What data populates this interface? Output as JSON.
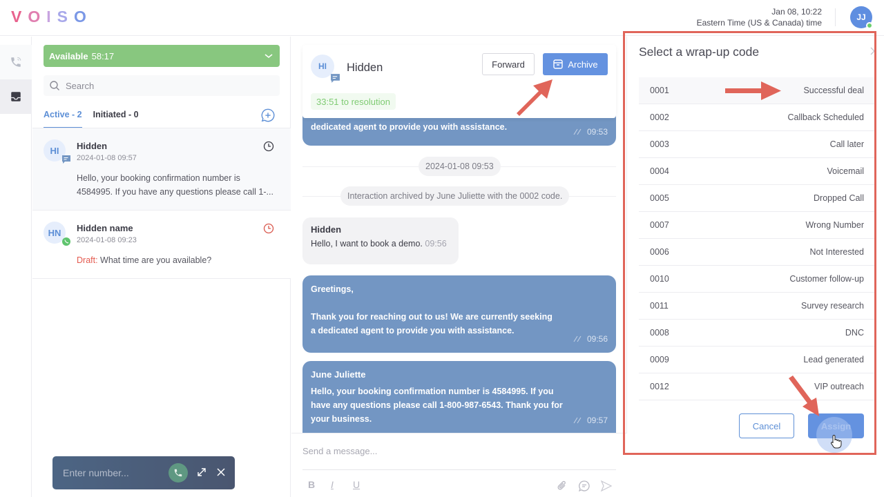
{
  "topbar": {
    "logo": "VOISO",
    "date": "Jan 08, 10:22",
    "timezone": "Eastern Time (US & Canada) time",
    "user_initials": "JJ",
    "user_status_color": "#6ccf6c"
  },
  "rail": {
    "items": [
      {
        "icon": "phone-icon",
        "label": "Calls"
      },
      {
        "icon": "inbox-icon",
        "label": "Inbox",
        "active": true
      }
    ]
  },
  "left_panel": {
    "status": {
      "label": "Available",
      "timer": "58:17",
      "color": "#88c77f"
    },
    "search_placeholder": "Search",
    "tabs": [
      {
        "label": "Active - 2",
        "active": true
      },
      {
        "label": "Initiated - 0",
        "active": false
      }
    ],
    "conversations": [
      {
        "initials": "HI",
        "channel": "sms",
        "name": "Hidden",
        "timestamp": "2024-01-08 09:57",
        "preview": "Hello, your booking confirmation number is 4584995. If you have any questions please call 1-...",
        "selected": true
      },
      {
        "initials": "HN",
        "channel": "whatsapp",
        "name": "Hidden name",
        "timestamp": "2024-01-08 09:23",
        "draft_label": "Draft:",
        "preview": "What time are you available?",
        "overdue": true
      }
    ]
  },
  "chat": {
    "header": {
      "initials": "HI",
      "title": "Hidden",
      "forward_label": "Forward",
      "archive_label": "Archive",
      "resolution": "33:51 to resolution"
    },
    "messages": [
      {
        "type": "outgoing",
        "text": "dedicated agent to provide you with assistance.",
        "time": "09:53"
      },
      {
        "type": "date",
        "text": "2024-01-08 09:53"
      },
      {
        "type": "system",
        "text": "Interaction archived by June Juliette with the 0002 code."
      },
      {
        "type": "incoming",
        "sender": "Hidden",
        "text": "Hello, I want to book a demo.",
        "time": "09:56"
      },
      {
        "type": "outgoing",
        "line1": "Greetings,",
        "text": "Thank you for reaching out to us! We are currently seeking a dedicated agent to provide you with assistance.",
        "time": "09:56"
      },
      {
        "type": "outgoing",
        "sender": "June Juliette",
        "text": "Hello, your booking confirmation number is 4584995. If you have any questions please call 1-800-987-6543. Thank you for your business.",
        "time": "09:57"
      }
    ],
    "composer": {
      "placeholder": "Send a message...",
      "bold": "B",
      "italic": "I",
      "underline": "U"
    }
  },
  "dialer": {
    "placeholder": "Enter number..."
  },
  "wrapup": {
    "title": "Select a wrap-up code",
    "codes": [
      {
        "code": "0001",
        "label": "Successful deal",
        "selected": true
      },
      {
        "code": "0002",
        "label": "Callback Scheduled"
      },
      {
        "code": "0003",
        "label": "Call later"
      },
      {
        "code": "0004",
        "label": "Voicemail"
      },
      {
        "code": "0005",
        "label": "Dropped Call"
      },
      {
        "code": "0007",
        "label": "Wrong Number"
      },
      {
        "code": "0006",
        "label": "Not Interested"
      },
      {
        "code": "0010",
        "label": "Customer follow-up"
      },
      {
        "code": "0011",
        "label": "Survey research"
      },
      {
        "code": "0008",
        "label": "DNC"
      },
      {
        "code": "0009",
        "label": "Lead generated"
      },
      {
        "code": "0012",
        "label": "VIP outreach"
      }
    ],
    "cancel_label": "Cancel",
    "assign_label": "Assign"
  },
  "colors": {
    "accent": "#6492e0",
    "outgoing_bubble": "#7396c3",
    "annotation": "#e0655a"
  }
}
